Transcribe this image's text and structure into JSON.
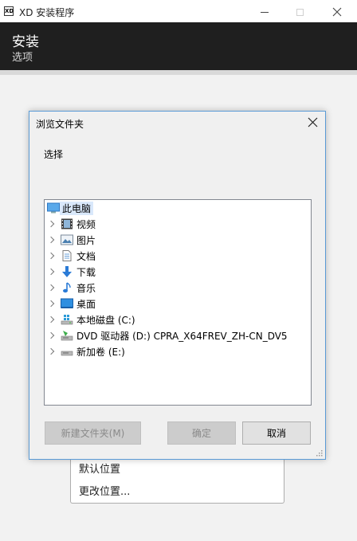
{
  "window": {
    "title": "XD 安装程序",
    "logo_text": "XD"
  },
  "header": {
    "title": "安装",
    "subtitle": "选项"
  },
  "location_menu": {
    "items": [
      "默认位置",
      "更改位置..."
    ]
  },
  "dialog": {
    "title": "浏览文件夹",
    "prompt": "选择",
    "tree": [
      {
        "label": "此电脑",
        "icon": "computer-icon",
        "selected": true
      },
      {
        "label": "视频",
        "icon": "video-icon"
      },
      {
        "label": "图片",
        "icon": "pictures-icon"
      },
      {
        "label": "文档",
        "icon": "documents-icon"
      },
      {
        "label": "下载",
        "icon": "download-icon"
      },
      {
        "label": "音乐",
        "icon": "music-icon"
      },
      {
        "label": "桌面",
        "icon": "desktop-icon"
      },
      {
        "label": "本地磁盘 (C:)",
        "icon": "windows-drive-icon"
      },
      {
        "label": "DVD 驱动器 (D:) CPRA_X64FREV_ZH-CN_DV5",
        "icon": "dvd-drive-icon"
      },
      {
        "label": "新加卷 (E:)",
        "icon": "drive-icon"
      }
    ],
    "buttons": {
      "new_folder": "新建文件夹(M)",
      "ok": "确定",
      "cancel": "取消"
    }
  },
  "colors": {
    "header_bg": "#1f1f1f",
    "dialog_border": "#5a9bd6",
    "selection": "#d9e8fb"
  }
}
